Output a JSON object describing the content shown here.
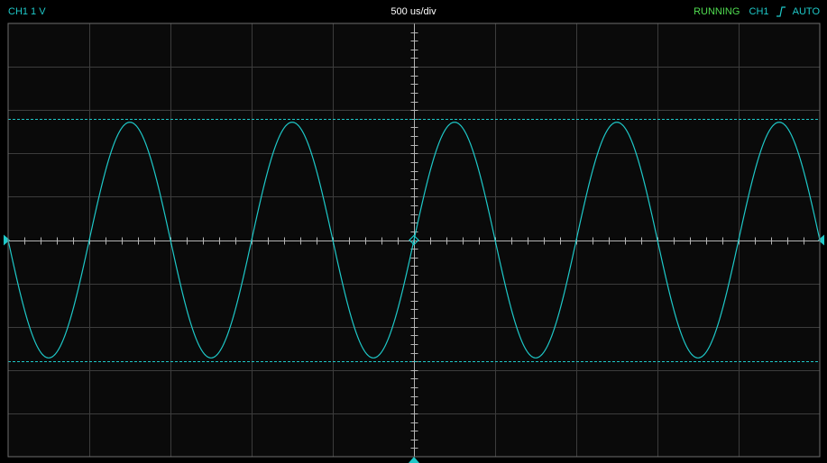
{
  "status_bar": {
    "channel_label": "CH1 1 V",
    "timebase": "500 us/div",
    "run_state": "RUNNING",
    "trigger_channel": "CH1",
    "trigger_edge_icon": "rising-edge-icon",
    "trigger_mode": "AUTO"
  },
  "colors": {
    "background": "#000000",
    "plot_background": "#0a0a0a",
    "grid": "#3c3c3c",
    "border": "#6e6e6e",
    "axis": "#b4b4b4",
    "trace": "#1ec8c8",
    "channel_label": "#1ec8c8",
    "run_state": "#50dc50",
    "timebase": "#ffffff"
  },
  "chart_data": {
    "type": "line",
    "title": "",
    "xlabel": "",
    "ylabel": "",
    "grid": true,
    "horizontal_divisions": 10,
    "vertical_divisions": 10,
    "minor_ticks_per_division": 5,
    "x_div_range": [
      -5,
      5
    ],
    "y_div_range": [
      -5,
      5
    ],
    "series": [
      {
        "waveform": "sine",
        "amplitude_div": 2.72,
        "cycles_on_screen": 5.0,
        "phase_deg_at_left": 180,
        "offset_div": 0
      }
    ],
    "cursors_div": [
      2.8,
      -2.8
    ],
    "trigger_level_div": 0,
    "trigger_position_div": 0
  }
}
